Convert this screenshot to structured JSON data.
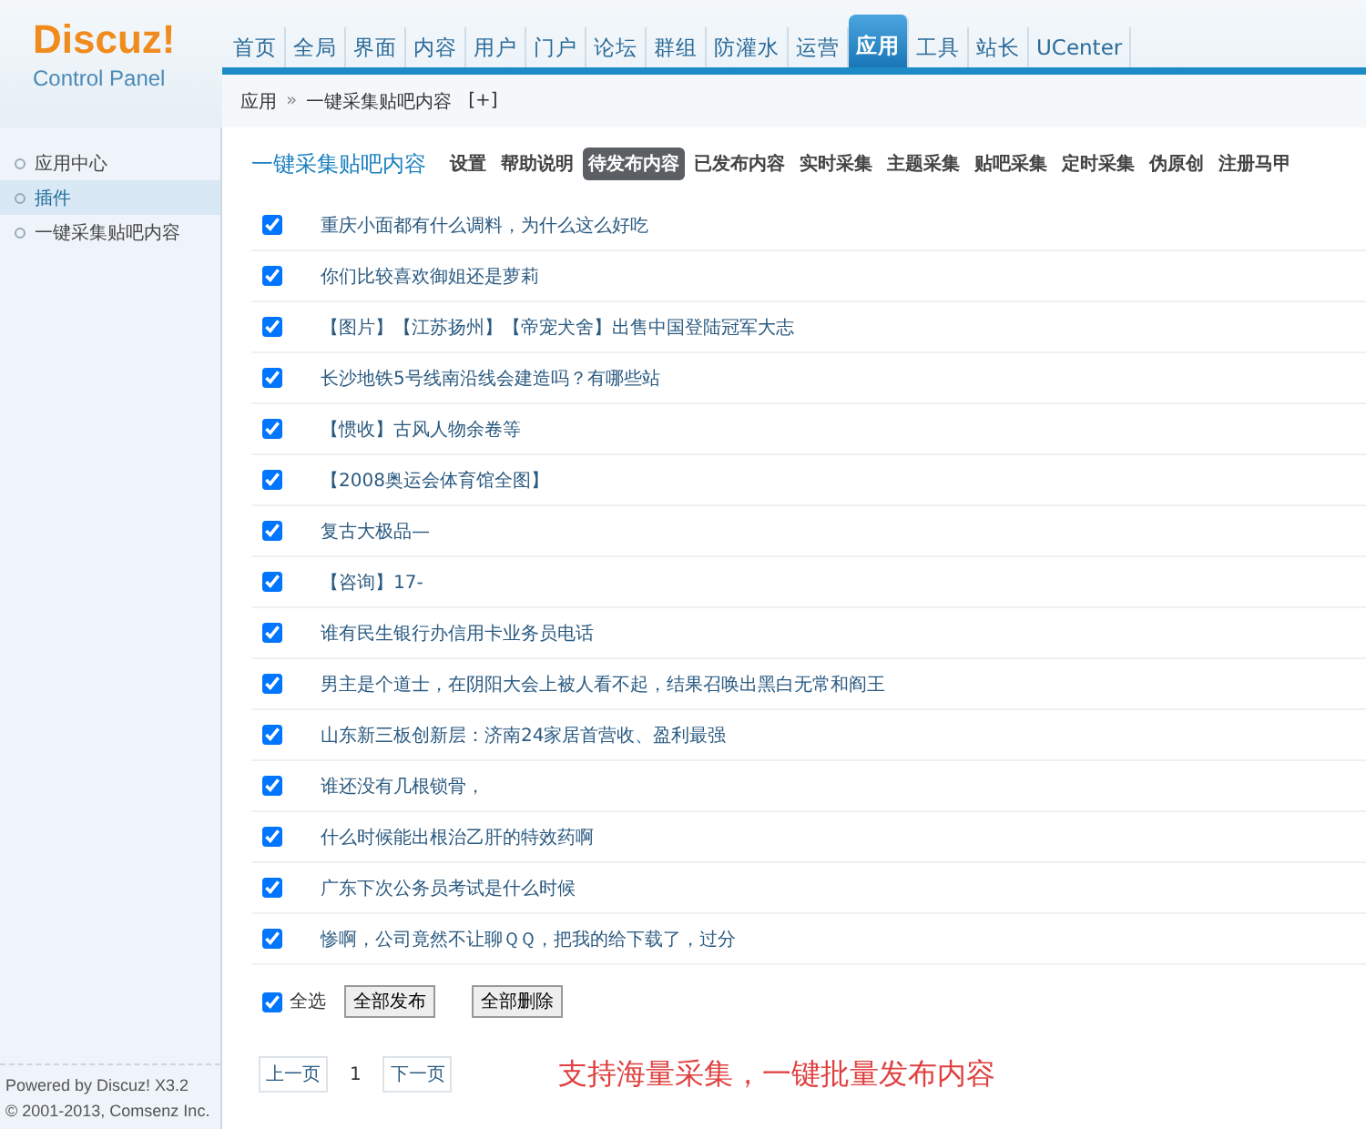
{
  "logo": {
    "name": "Discuz!",
    "subtitle": "Control Panel"
  },
  "nav": [
    {
      "label": "首页",
      "selected": false
    },
    {
      "label": "全局",
      "selected": false
    },
    {
      "label": "界面",
      "selected": false
    },
    {
      "label": "内容",
      "selected": false
    },
    {
      "label": "用户",
      "selected": false
    },
    {
      "label": "门户",
      "selected": false
    },
    {
      "label": "论坛",
      "selected": false
    },
    {
      "label": "群组",
      "selected": false
    },
    {
      "label": "防灌水",
      "selected": false
    },
    {
      "label": "运营",
      "selected": false
    },
    {
      "label": "应用",
      "selected": true
    },
    {
      "label": "工具",
      "selected": false
    },
    {
      "label": "站长",
      "selected": false
    },
    {
      "label": "UCenter",
      "selected": false
    }
  ],
  "breadcrumb": {
    "parent": "应用",
    "separator": "»",
    "current": "一键采集贴吧内容",
    "add": "[+]"
  },
  "sidebar": {
    "items": [
      {
        "label": "应用中心",
        "selected": false
      },
      {
        "label": "插件",
        "selected": true
      },
      {
        "label": "一键采集贴吧内容",
        "selected": false
      }
    ],
    "footer": [
      "Powered by Discuz! X3.2",
      "© 2001-2013, Comsenz Inc."
    ]
  },
  "plugin_title": "一键采集贴吧内容",
  "tabs": [
    {
      "label": "设置",
      "selected": false
    },
    {
      "label": "帮助说明",
      "selected": false
    },
    {
      "label": "待发布内容",
      "selected": true
    },
    {
      "label": "已发布内容",
      "selected": false
    },
    {
      "label": "实时采集",
      "selected": false
    },
    {
      "label": "主题采集",
      "selected": false
    },
    {
      "label": "贴吧采集",
      "selected": false
    },
    {
      "label": "定时采集",
      "selected": false
    },
    {
      "label": "伪原创",
      "selected": false
    },
    {
      "label": "注册马甲",
      "selected": false
    }
  ],
  "rows": [
    {
      "title": "重庆小面都有什么调料，为什么这么好吃",
      "checked": true
    },
    {
      "title": "你们比较喜欢御姐还是萝莉",
      "checked": true
    },
    {
      "title": "【图片】【江苏扬州】【帝宠犬舍】出售中国登陆冠军大志",
      "checked": true
    },
    {
      "title": "长沙地铁5号线南沿线会建造吗？有哪些站",
      "checked": true
    },
    {
      "title": "【惯收】古风人物余卷等",
      "checked": true
    },
    {
      "title": "【2008奥运会体育馆全图】",
      "checked": true
    },
    {
      "title": "复古大极品—",
      "checked": true
    },
    {
      "title": "【咨询】17-",
      "checked": true
    },
    {
      "title": "谁有民生银行办信用卡业务员电话",
      "checked": true
    },
    {
      "title": "男主是个道士，在阴阳大会上被人看不起，结果召唤出黑白无常和阎王",
      "checked": true
    },
    {
      "title": "山东新三板创新层：济南24家居首营收、盈利最强",
      "checked": true
    },
    {
      "title": "谁还没有几根锁骨，",
      "checked": true
    },
    {
      "title": "什么时候能出根治乙肝的特效药啊",
      "checked": true
    },
    {
      "title": "广东下次公务员考试是什么时候",
      "checked": true
    },
    {
      "title": "惨啊，公司竟然不让聊ＱＱ，把我的给下载了，过分",
      "checked": true
    }
  ],
  "select_all": {
    "label": "全选",
    "checked": true
  },
  "actions": [
    "全部发布",
    "全部删除"
  ],
  "pagination": {
    "prev": "上一页",
    "current": "1",
    "next": "下一页"
  },
  "caption": "支持海量采集，一键批量发布内容"
}
